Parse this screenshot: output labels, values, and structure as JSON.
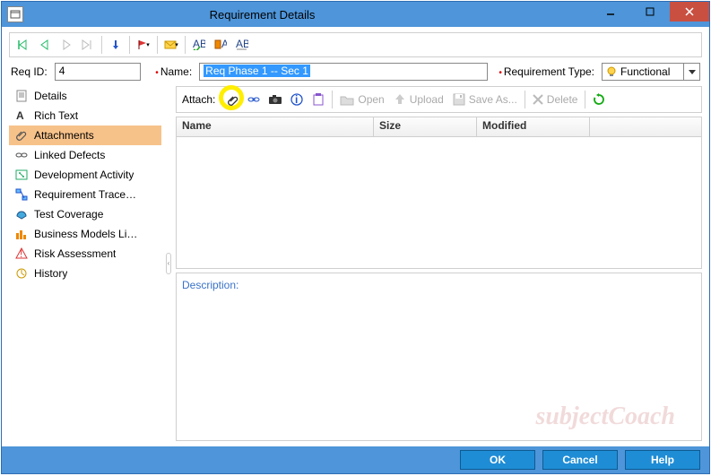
{
  "window": {
    "title": "Requirement Details"
  },
  "fields": {
    "reqid_label": "Req ID:",
    "reqid_value": "4",
    "name_label": "Name:",
    "name_value": "Req Phase 1 -- Sec 1",
    "rtype_label": "Requirement Type:",
    "rtype_value": "Functional"
  },
  "sidebar": {
    "items": [
      {
        "label": "Details"
      },
      {
        "label": "Rich Text"
      },
      {
        "label": "Attachments"
      },
      {
        "label": "Linked Defects"
      },
      {
        "label": "Development Activity"
      },
      {
        "label": "Requirement Trace…"
      },
      {
        "label": "Test Coverage"
      },
      {
        "label": "Business Models Li…"
      },
      {
        "label": "Risk Assessment"
      },
      {
        "label": "History"
      }
    ]
  },
  "attach": {
    "label": "Attach:",
    "open": "Open",
    "upload": "Upload",
    "saveas": "Save As...",
    "delete": "Delete"
  },
  "grid": {
    "cols": {
      "name": "Name",
      "size": "Size",
      "modified": "Modified"
    }
  },
  "description": {
    "label": "Description:"
  },
  "footer": {
    "ok": "OK",
    "cancel": "Cancel",
    "help": "Help"
  },
  "watermark": "subjectCoach"
}
